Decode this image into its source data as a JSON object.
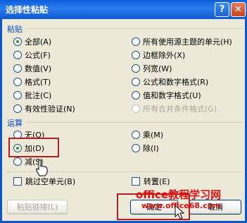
{
  "window": {
    "title": "选择性粘贴",
    "help_glyph": "?",
    "close_glyph": "✕"
  },
  "paste": {
    "label": "粘贴",
    "options_left": [
      "全部(A)",
      "公式(F)",
      "数值(V)",
      "格式(T)",
      "批注(C)",
      "有效性验证(N)"
    ],
    "options_right": [
      "所有使用源主题的单元(H)",
      "边框除外(X)",
      "列宽(W)",
      "公式和数字格式(R)",
      "值和数字格式(U)",
      "所有合并条件格式(G)"
    ],
    "selected": "全部(A)"
  },
  "operation": {
    "label": "运算",
    "options_left": [
      "无(O)",
      "加(D)",
      "减(S)"
    ],
    "options_right": [
      "乘(M)",
      "除(I)"
    ],
    "selected": "加(D)"
  },
  "checkboxes": {
    "skip_blanks": "跳过空单元(B)",
    "transpose": "转置(E)"
  },
  "buttons": {
    "paste_link": "粘贴链接(L)",
    "ok": "确定",
    "cancel": "取消"
  },
  "watermark": {
    "line1": "office教程学习网",
    "line2": "www.office68.com"
  },
  "colors": {
    "titlebar": "#0a5fd9",
    "group_label": "#0046d5",
    "highlight_box": "#b22222",
    "watermark": "#e01010"
  }
}
